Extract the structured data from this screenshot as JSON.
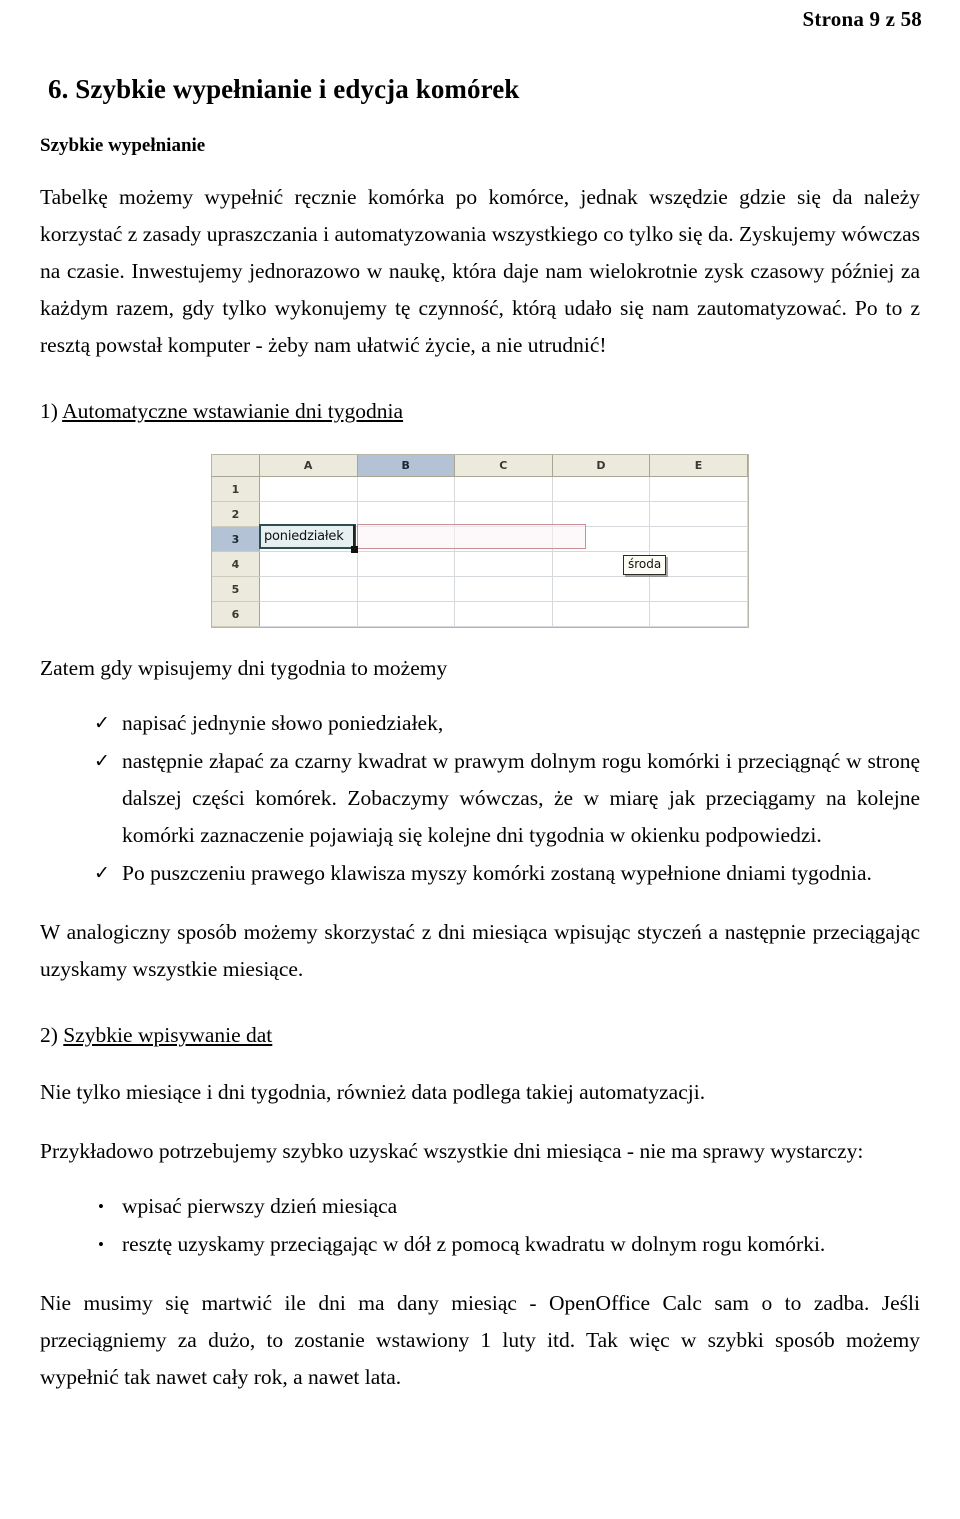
{
  "header": {
    "page_label": "Strona 9 z 58"
  },
  "chapter": {
    "title": "6. Szybkie wypełnianie i edycja komórek",
    "subheading": "Szybkie wypełnianie"
  },
  "intro": {
    "paragraph1": "Tabelkę możemy wypełnić ręcznie komórka po komórce, jednak wszędzie gdzie się da należy korzystać z zasady upraszczania i automatyzowania wszystkiego co tylko się da. Zyskujemy wówczas na czasie. Inwestujemy jednorazowo w naukę, która daje nam wielokrotnie zysk czasowy później za każdym razem, gdy tylko wykonujemy tę czynność, którą udało się nam zautomatyzować. Po to z resztą powstał komputer - żeby nam ułatwić życie, a nie utrudnić!"
  },
  "section1": {
    "number": "1)",
    "title": "Automatyczne wstawianie dni tygodnia",
    "lead_in": "Zatem gdy wpisujemy dni tygodnia to możemy",
    "bullets": [
      "napisać jednynie słowo poniedziałek,",
      "następnie złapać za czarny kwadrat w prawym dolnym rogu komórki i przeciągnąć w stronę dalszej części komórek. Zobaczymy wówczas, że w miarę jak przeciągamy na kolejne komórki zaznaczenie pojawiają się kolejne dni tygodnia w okienku podpowiedzi.",
      "Po puszczeniu prawego klawisza myszy komórki zostaną wypełnione dniami tygodnia."
    ],
    "bullet_marker": "✓",
    "closing": "W analogiczny sposób możemy skorzystać z dni miesiąca wpisując styczeń a następnie przeciągając uzyskamy wszystkie miesiące."
  },
  "spreadsheet": {
    "columns": [
      "A",
      "B",
      "C",
      "D",
      "E"
    ],
    "rows": [
      "1",
      "2",
      "3",
      "4",
      "5",
      "6"
    ],
    "selected_column": "B",
    "selected_row": "3",
    "active_cell_value": "poniedziałek",
    "tooltip_value": "środa",
    "colors": {
      "header_fill": "#ece9dd",
      "header_selected_fill": "#b3c2d4",
      "grid_line": "#d5d9dd",
      "active_cell_border": "#2e4d50",
      "drag_range_border": "#c98f96"
    }
  },
  "section2": {
    "number": "2)",
    "title": "Szybkie wpisywanie dat",
    "paragraph1": "Nie tylko miesiące i dni tygodnia, również data podlega takiej automatyzacji.",
    "paragraph2": "Przykładowo potrzebujemy szybko uzyskać wszystkie dni miesiąca - nie ma sprawy wystarczy:",
    "bullet_marker": "•",
    "bullets": [
      "wpisać pierwszy dzień miesiąca",
      "resztę uzyskamy przeciągając w dół z pomocą kwadratu w dolnym rogu komórki."
    ],
    "closing": "Nie musimy się martwić ile dni ma dany miesiąc - OpenOffice Calc sam o to zadba. Jeśli przeciągniemy za dużo, to zostanie wstawiony 1 luty itd. Tak więc w szybki sposób możemy wypełnić tak nawet cały rok, a nawet lata."
  }
}
